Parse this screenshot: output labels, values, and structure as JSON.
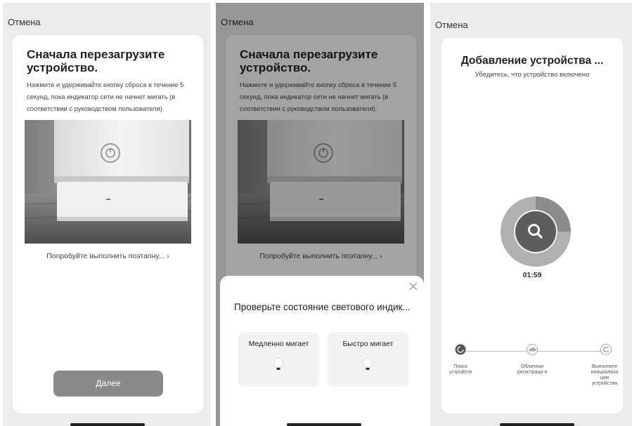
{
  "screen1": {
    "cancel": "Отмена",
    "title": "Сначала перезагрузите устройство.",
    "description": "Нажмите и удерживайте кнопку сброса в течение 5 секунд, пока индикатор сети не начнет мигать  (в соответствии с руководством пользователя).",
    "step_link": "Попробуйте выполнить поэтапну... ›",
    "next_button": "Далее"
  },
  "screen2": {
    "cancel": "Отмена",
    "title": "Сначала перезагрузите устройство.",
    "description": "Нажмите и удерживайте кнопку сброса в течение 5 секунд, пока индикатор сети не начнет мигать  (в соответствии с руководством пользователя).",
    "step_link": "Попробуйте выполнить поэтапну... ›",
    "sheet": {
      "title": "Проверьте состояние светового индик...",
      "options": [
        "Медленно мигает",
        "Быстро мигает"
      ]
    }
  },
  "screen3": {
    "cancel": "Отмена",
    "title": "Добавление устройства ...",
    "subtitle": "Убедитесь, что устройство включено",
    "timer": "01:59",
    "progress_fraction": 0.25,
    "steps": [
      {
        "label": "Поиск устройств",
        "icon": "search-step-icon",
        "active": true
      },
      {
        "label": "Облачная регистраци я",
        "icon": "cloud-icon",
        "active": false
      },
      {
        "label": "Выполните инициализа цию устройства",
        "icon": "refresh-icon",
        "active": false
      }
    ]
  },
  "colors": {
    "button": "#8a8a8a",
    "ring_light": "#b0b0b0",
    "ring_dark": "#8c8c8c",
    "center_dark": "#5d5d5d"
  }
}
